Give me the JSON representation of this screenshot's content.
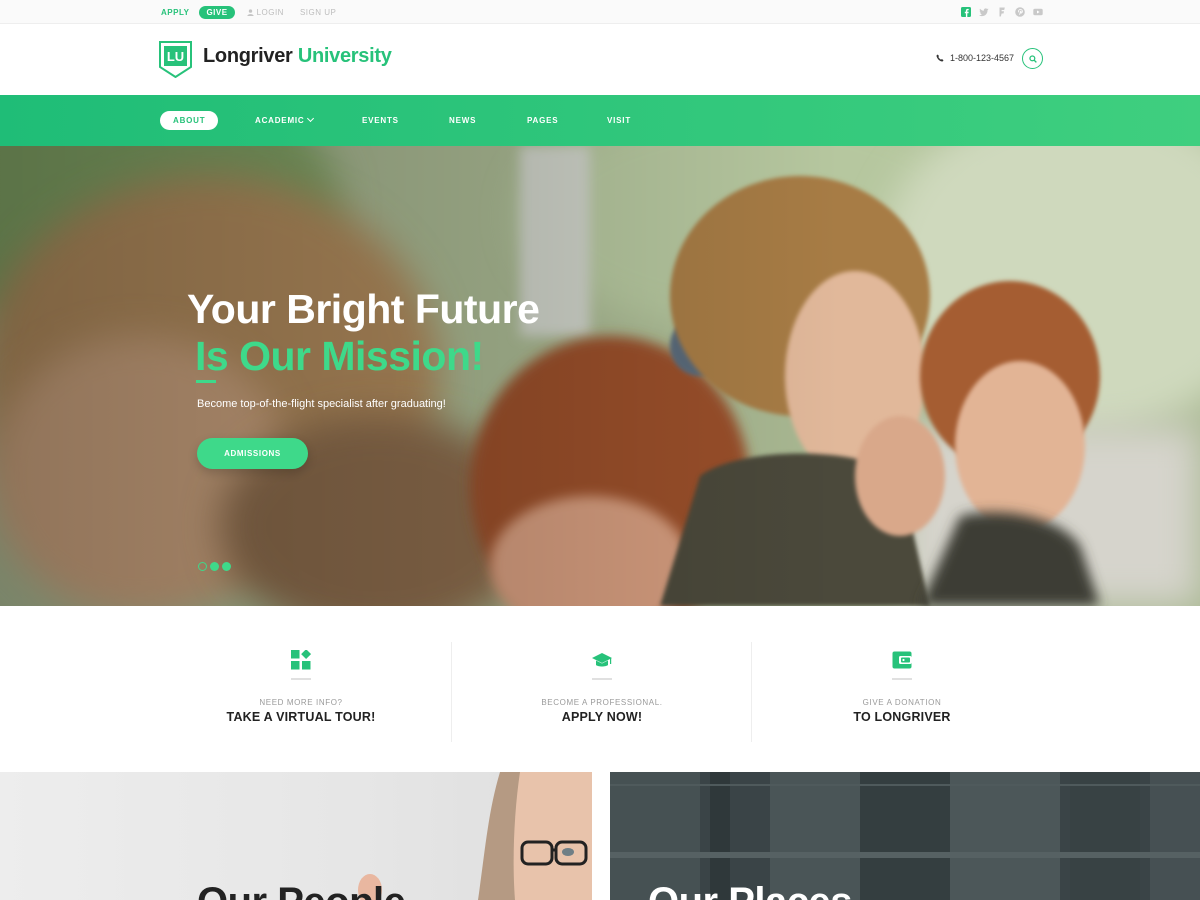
{
  "topbar": {
    "apply": "APPLY",
    "give": "GIVE",
    "login": "LOGIN",
    "signup": "SIGN UP",
    "social_icons": [
      "facebook-icon",
      "twitter-icon",
      "foursquare-icon",
      "pinterest-icon",
      "youtube-icon"
    ]
  },
  "header": {
    "logo_text": "LU",
    "brand_first": "Longriver",
    "brand_second": "University",
    "phone": "1-800-123-4567"
  },
  "nav": {
    "items": [
      {
        "label": "ABOUT",
        "active": true
      },
      {
        "label": "ACADEMIC",
        "has_dropdown": true
      },
      {
        "label": "EVENTS"
      },
      {
        "label": "NEWS"
      },
      {
        "label": "PAGES"
      },
      {
        "label": "VISIT"
      }
    ]
  },
  "hero": {
    "title_line1": "Your Bright Future",
    "title_line2": "Is Our Mission!",
    "subtitle": "Become top-of-the-flight specialist after graduating!",
    "cta": "ADMISSIONS",
    "slide_count": 3,
    "active_slide": 1
  },
  "features": [
    {
      "icon": "apps-icon",
      "small": "NEED MORE INFO?",
      "big": "TAKE A VIRTUAL TOUR!"
    },
    {
      "icon": "graduation-cap-icon",
      "small": "BECOME A PROFESSIONAL.",
      "big": "APPLY NOW!"
    },
    {
      "icon": "wallet-icon",
      "small": "GIVE A DONATION",
      "big": "TO LONGRIVER"
    }
  ],
  "cards": {
    "left_title": "Our People",
    "right_title": "Our Places"
  },
  "colors": {
    "accent": "#27c27a",
    "accent_light": "#3ed98a",
    "dark": "#222222",
    "card_dark": "#3b4547"
  }
}
